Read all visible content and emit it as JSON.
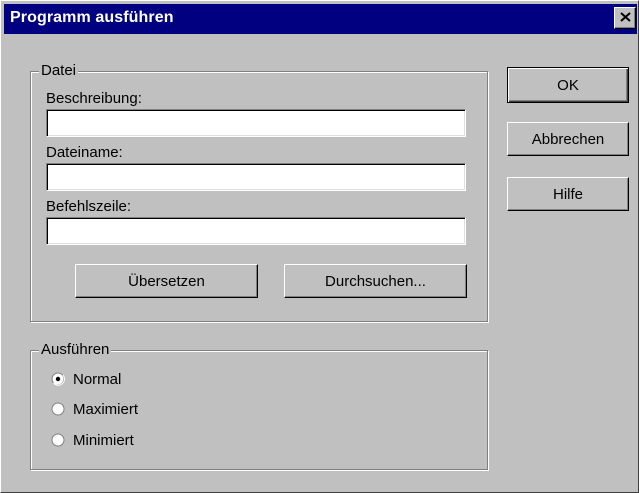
{
  "window": {
    "title": "Programm ausführen",
    "close_icon": "close-icon"
  },
  "datei_group": {
    "label": "Datei",
    "beschreibung": {
      "label": "Beschreibung:",
      "value": ""
    },
    "dateiname": {
      "label": "Dateiname:",
      "value": ""
    },
    "befehlszeile": {
      "label": "Befehlszeile:",
      "value": ""
    },
    "uebersetzen_label": "Übersetzen",
    "durchsuchen_label": "Durchsuchen..."
  },
  "ausfuehren_group": {
    "label": "Ausführen",
    "options": [
      {
        "label": "Normal",
        "selected": true
      },
      {
        "label": "Maximiert",
        "selected": false
      },
      {
        "label": "Minimiert",
        "selected": false
      }
    ]
  },
  "buttons": {
    "ok_label": "OK",
    "abbrechen_label": "Abbrechen",
    "hilfe_label": "Hilfe"
  },
  "colors": {
    "titlebar": "#000080",
    "face": "#c0c0c0"
  }
}
